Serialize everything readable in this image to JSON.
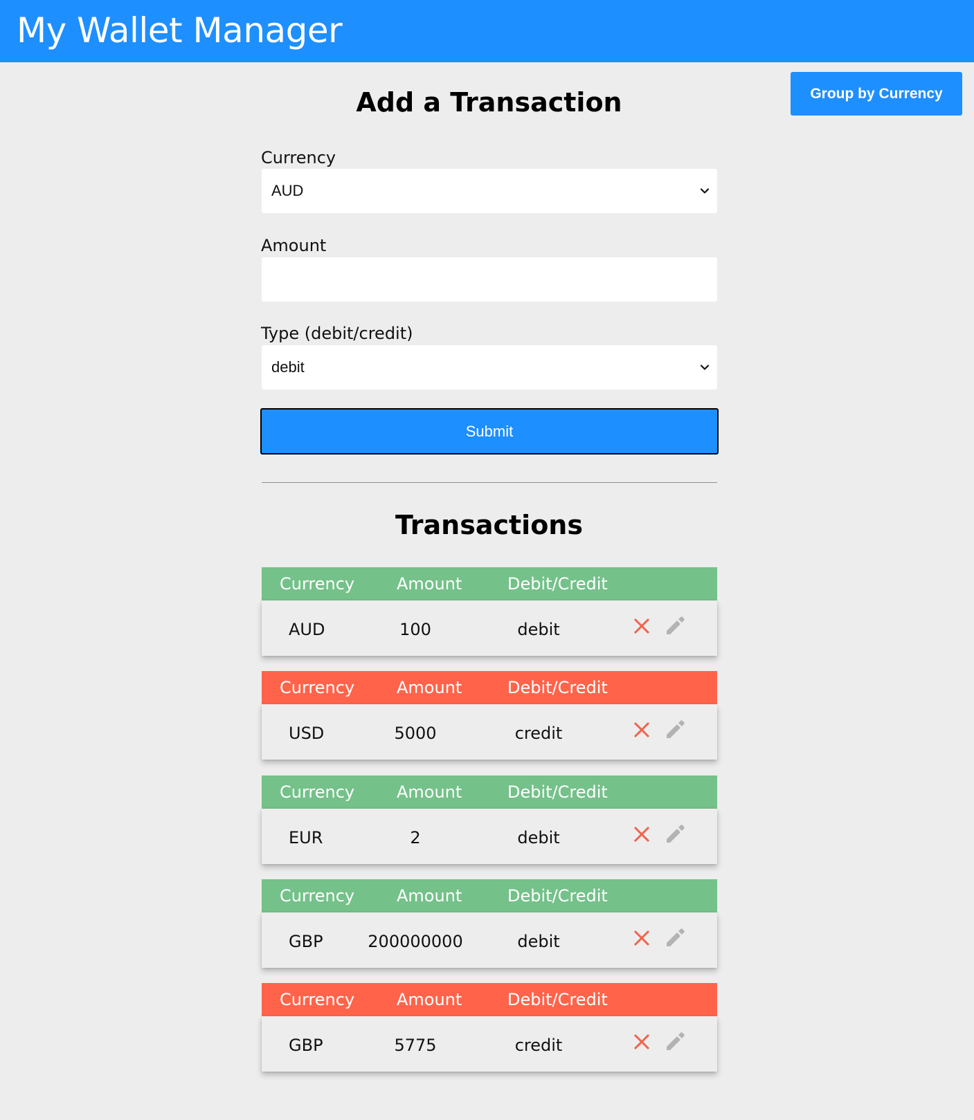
{
  "app": {
    "title": "My Wallet Manager"
  },
  "toolbar": {
    "group_label": "Group by Currency"
  },
  "form": {
    "title": "Add a Transaction",
    "currency_label": "Currency",
    "currency_value": "AUD",
    "amount_label": "Amount",
    "amount_value": "",
    "type_label": "Type (debit/credit)",
    "type_value": "debit",
    "submit_label": "Submit"
  },
  "transactions": {
    "title": "Transactions",
    "header": {
      "currency": "Currency",
      "amount": "Amount",
      "type": "Debit/Credit"
    },
    "items": [
      {
        "currency": "AUD",
        "amount": "100",
        "type": "debit"
      },
      {
        "currency": "USD",
        "amount": "5000",
        "type": "credit"
      },
      {
        "currency": "EUR",
        "amount": "2",
        "type": "debit"
      },
      {
        "currency": "GBP",
        "amount": "200000000",
        "type": "debit"
      },
      {
        "currency": "GBP",
        "amount": "5775",
        "type": "credit"
      }
    ]
  },
  "colors": {
    "primary": "#1e8fff",
    "debit": "#74c189",
    "credit": "#ff644b",
    "delete_icon": "#f0624a",
    "edit_icon": "#b3b3b3",
    "background": "#ededed"
  },
  "icons": {
    "delete": "close-icon",
    "edit": "pencil-icon",
    "dropdown": "chevron-down-icon"
  }
}
